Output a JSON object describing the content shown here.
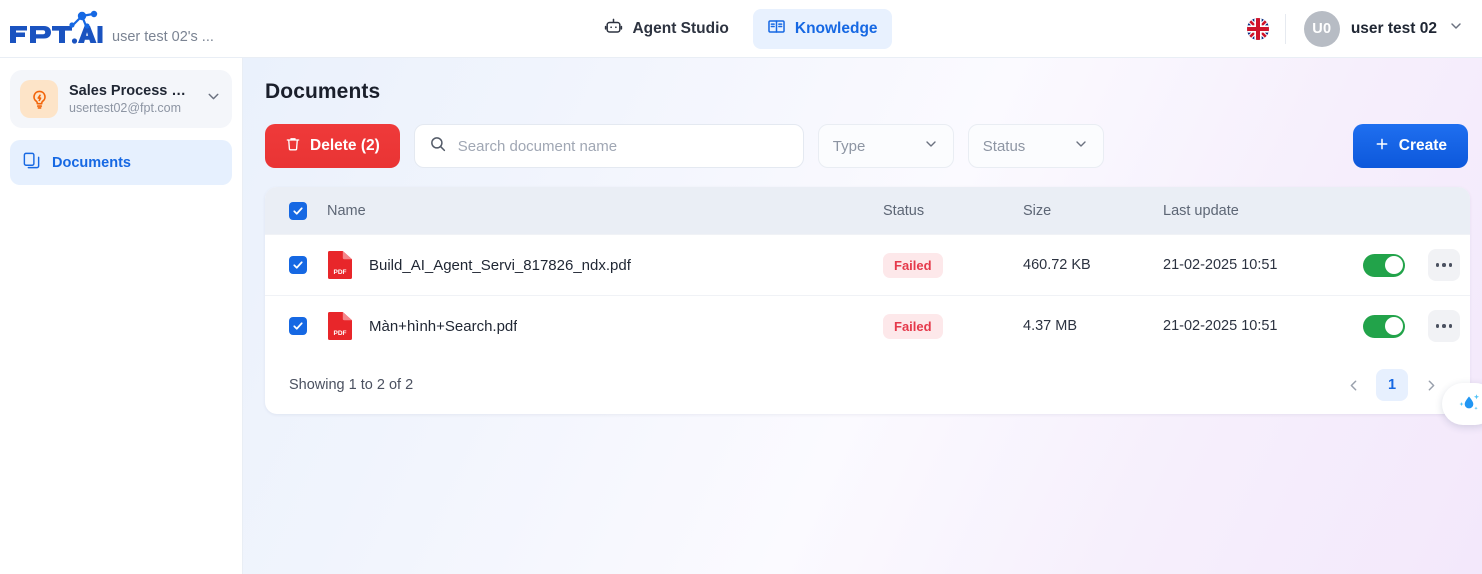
{
  "header": {
    "logo_text": "FPT.AI",
    "workspace_label": "user test 02's ...",
    "nav": [
      {
        "label": "Agent Studio",
        "icon": "robot-icon",
        "active": false
      },
      {
        "label": "Knowledge",
        "icon": "book-icon",
        "active": true
      }
    ],
    "language_icon": "uk-flag-icon",
    "avatar_initials": "U0",
    "user_name": "user test 02",
    "user_chevron": "chevron-down-icon"
  },
  "sidebar": {
    "knowledge_base": {
      "title": "Sales Process & ...",
      "email": "usertest02@fpt.com",
      "icon": "lightbulb-icon",
      "chevron": "chevron-down-icon"
    },
    "items": [
      {
        "label": "Documents",
        "icon": "documents-icon",
        "active": true
      }
    ]
  },
  "main": {
    "page_title": "Documents",
    "toolbar": {
      "delete_label": "Delete (2)",
      "delete_icon": "trash-icon",
      "search_placeholder": "Search document name",
      "search_value": "",
      "search_icon": "search-icon",
      "type_filter": "Type",
      "status_filter": "Status",
      "create_label": "Create",
      "create_icon": "plus-icon"
    },
    "table": {
      "headers": {
        "name": "Name",
        "status": "Status",
        "size": "Size",
        "last_update": "Last update"
      },
      "select_all_checked": true,
      "rows": [
        {
          "checked": true,
          "file_icon": "pdf-file-icon",
          "name": "Build_AI_Agent_Servi_817826_ndx.pdf",
          "status": "Failed",
          "size": "460.72 KB",
          "last_update": "21-02-2025 10:51",
          "enabled": true,
          "actions_icon": "kebab-menu-icon"
        },
        {
          "checked": true,
          "file_icon": "pdf-file-icon",
          "name": "Màn+hình+Search.pdf",
          "status": "Failed",
          "size": "4.37 MB",
          "last_update": "21-02-2025 10:51",
          "enabled": true,
          "actions_icon": "kebab-menu-icon"
        }
      ]
    },
    "footer": {
      "showing": "Showing 1 to 2 of 2",
      "prev_icon": "chevron-left-icon",
      "current_page": "1",
      "next_icon": "chevron-right-icon"
    },
    "float_widget_icon": "water-drop-sparkle-icon"
  },
  "colors": {
    "brand_blue": "#1668e3",
    "danger_red": "#e93434",
    "badge_bg": "#fde8ea",
    "badge_text": "#e5394b",
    "toggle_on": "#22a34a",
    "kb_icon_bg": "#fde4c8",
    "kb_icon_fg": "#f2640a"
  }
}
